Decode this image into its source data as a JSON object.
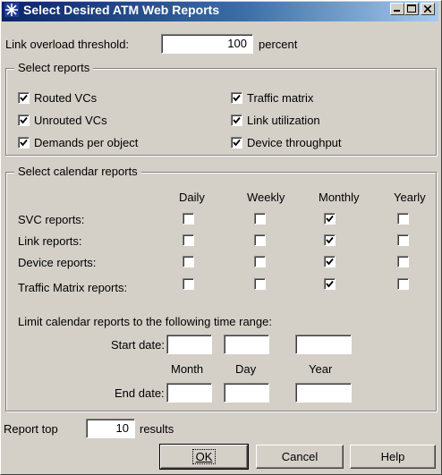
{
  "window": {
    "title": "Select Desired ATM Web Reports",
    "app_icon": "star-burst-icon",
    "controls": [
      "minimize-icon",
      "maximize-icon",
      "close-icon"
    ]
  },
  "threshold": {
    "label": "Link overload threshold:",
    "value": "100",
    "unit": "percent"
  },
  "select_reports": {
    "legend": "Select reports",
    "items": [
      {
        "label": "Routed VCs",
        "checked": true
      },
      {
        "label": "Unrouted VCs",
        "checked": true
      },
      {
        "label": "Demands per object",
        "checked": true
      },
      {
        "label": "Traffic matrix",
        "checked": true
      },
      {
        "label": "Link utilization",
        "checked": true
      },
      {
        "label": "Device throughput",
        "checked": true
      }
    ]
  },
  "calendar": {
    "legend": "Select calendar reports",
    "columns": [
      "Daily",
      "Weekly",
      "Monthly",
      "Yearly"
    ],
    "rows": [
      {
        "label": "SVC reports:",
        "checks": [
          false,
          false,
          true,
          false
        ]
      },
      {
        "label": "Link reports:",
        "checks": [
          false,
          false,
          true,
          false
        ]
      },
      {
        "label": "Device reports:",
        "checks": [
          false,
          false,
          true,
          false
        ]
      },
      {
        "label": "Traffic Matrix reports:",
        "checks": [
          false,
          false,
          true,
          false
        ]
      }
    ],
    "limit_text": "Limit calendar reports to the following time range:",
    "start_label": "Start date:",
    "end_label": "End date:",
    "date_headers": [
      "Month",
      "Day",
      "Year"
    ],
    "start_values": [
      "",
      "",
      ""
    ],
    "end_values": [
      "",
      "",
      ""
    ]
  },
  "report_top": {
    "label": "Report top",
    "value": "10",
    "suffix": "results"
  },
  "buttons": {
    "ok": "OK",
    "cancel": "Cancel",
    "help": "Help"
  },
  "colors": {
    "face": "#d4d0c8",
    "title_start": "#0a246a",
    "title_end": "#a6caf0"
  }
}
